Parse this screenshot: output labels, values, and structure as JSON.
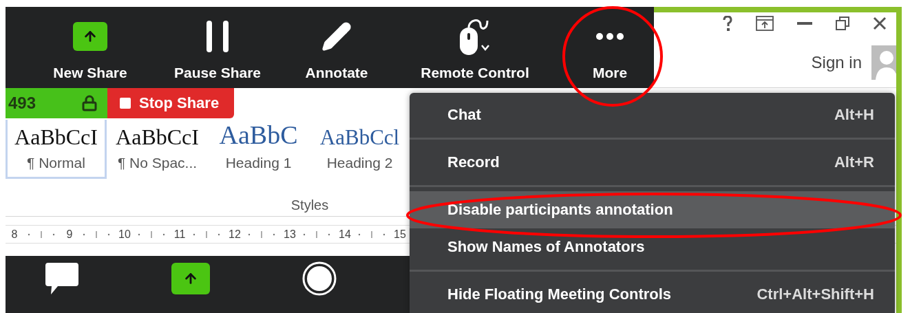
{
  "share_toolbar": {
    "buttons": [
      {
        "kind": "new_share",
        "label": "New Share"
      },
      {
        "kind": "pause",
        "label": "Pause Share"
      },
      {
        "kind": "annotate",
        "label": "Annotate"
      },
      {
        "kind": "remote_control",
        "label": "Remote Control"
      },
      {
        "kind": "more",
        "label": "More"
      }
    ]
  },
  "meeting_id": {
    "text": "493"
  },
  "stop_share": {
    "label": "Stop Share"
  },
  "word": {
    "account": {
      "label": "Sign in"
    },
    "styles_gallery": {
      "items": [
        {
          "kind": "body",
          "sample": "AaBbCcI",
          "name": "¶ Normal",
          "selected": true
        },
        {
          "kind": "body",
          "sample": "AaBbCcI",
          "name": "¶ No Spac...",
          "selected": false
        },
        {
          "kind": "heading1",
          "sample": "AaBbC",
          "name": "Heading 1",
          "selected": false
        },
        {
          "kind": "heading2",
          "sample": "AaBbCcl",
          "name": "Heading 2",
          "selected": false
        }
      ],
      "group_label": "Styles"
    },
    "ruler": {
      "marks": [
        "8",
        "9",
        "10",
        "11",
        "12",
        "13",
        "14",
        "15"
      ]
    }
  },
  "meeting_controls": {
    "buttons": [
      {
        "kind": "chat"
      },
      {
        "kind": "share_screen"
      },
      {
        "kind": "record"
      }
    ]
  },
  "more_menu": {
    "items": [
      {
        "label": "Chat",
        "shortcut": "Alt+H",
        "selected": false,
        "separator_after": true
      },
      {
        "label": "Record",
        "shortcut": "Alt+R",
        "selected": false,
        "separator_after": true
      },
      {
        "label": "Disable participants annotation",
        "selected": true,
        "separator_after": false
      },
      {
        "label": "Show Names of Annotators",
        "selected": false,
        "separator_after": true
      },
      {
        "label": "Hide Floating Meeting Controls",
        "shortcut": "Ctrl+Alt+Shift+H",
        "selected": false,
        "separator_after": false
      }
    ]
  }
}
